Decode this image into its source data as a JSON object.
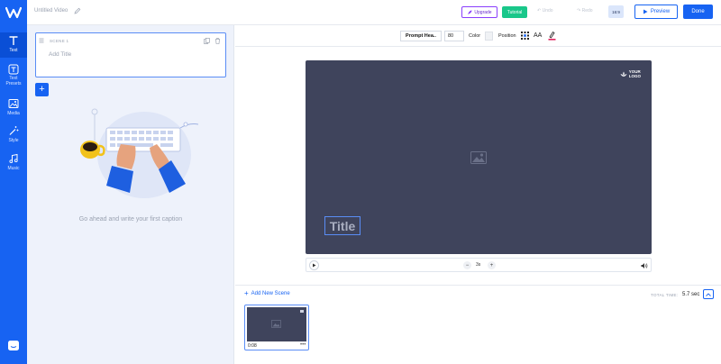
{
  "app": {
    "video_title": "Untitled Video"
  },
  "rail": {
    "items": [
      {
        "label": "Text",
        "icon": "text-icon"
      },
      {
        "label": "Text\nPresets",
        "icon": "text-presets-icon"
      },
      {
        "label": "Media",
        "icon": "media-icon"
      },
      {
        "label": "Style",
        "icon": "magic-wand-icon"
      },
      {
        "label": "Music",
        "icon": "music-icon"
      }
    ],
    "accent": "#1763f2"
  },
  "topbar": {
    "upgrade_label": "Upgrade",
    "tutorial_label": "Tutorial",
    "undo_label": "Undo",
    "redo_label": "Redo",
    "ratio_label": "16:9",
    "preview_label": "Preview",
    "done_label": "Done"
  },
  "scene_panel": {
    "scene_label": "SCENE 1",
    "title_placeholder": "Add Title",
    "add_button": "+",
    "empty_caption": "Go ahead and write your first caption"
  },
  "editbar": {
    "font": "Prompt Hea..",
    "size": "80",
    "color_label": "Color",
    "position_label": "Position",
    "case_label": "AA"
  },
  "canvas": {
    "logo_text": "YOUR\nLOGO",
    "title_text": "Title",
    "background": "#3f445c"
  },
  "playbar": {
    "minus": "−",
    "speed": "3s",
    "plus": "+"
  },
  "timeline": {
    "add_scene_label": "Add New Scene",
    "total_time_label": "TOTAL TIME:",
    "total_time_value": "5.7 sec",
    "scenes": [
      {
        "duration": "0:08",
        "more": "•••"
      }
    ]
  }
}
